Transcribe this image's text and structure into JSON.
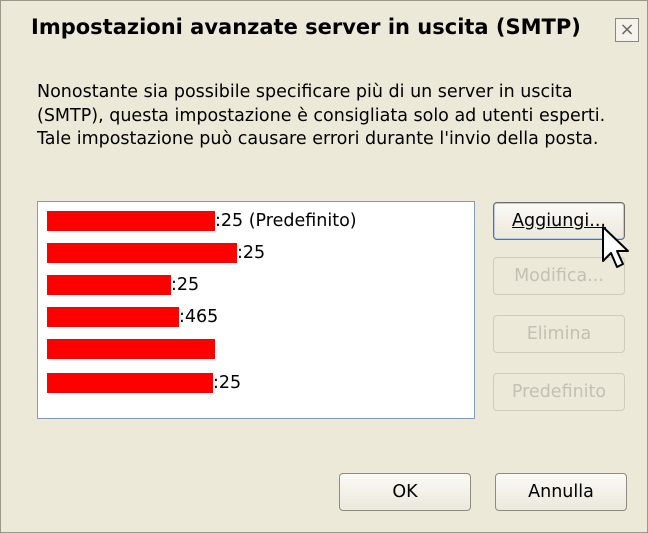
{
  "window": {
    "title": "Impostazioni avanzate server in uscita (SMTP)",
    "close_glyph": "×"
  },
  "description": "Nonostante sia possibile specificare più di un server in uscita (SMTP), questa impostazione è consigliata solo ad utenti esperti. Tale impostazione può causare errori durante l'invio della posta.",
  "servers": [
    {
      "port": ":25 (Predefinito)",
      "redacted": true
    },
    {
      "port": ":25",
      "redacted": true
    },
    {
      "port": ":25",
      "redacted": true
    },
    {
      "port": ":465",
      "redacted": true
    },
    {
      "port": "",
      "redacted": true
    },
    {
      "port": ":25",
      "redacted": true
    }
  ],
  "buttons": {
    "add": "Aggiungi...",
    "edit": "Modifica...",
    "delete": "Elimina",
    "default": "Predefinito",
    "ok": "OK",
    "cancel": "Annulla"
  },
  "colors": {
    "dialog_bg": "#ece9d8",
    "redaction": "#ff0000",
    "list_border": "#7f9db9"
  },
  "icons": {
    "close": "close-icon",
    "cursor": "mouse-pointer-icon"
  }
}
